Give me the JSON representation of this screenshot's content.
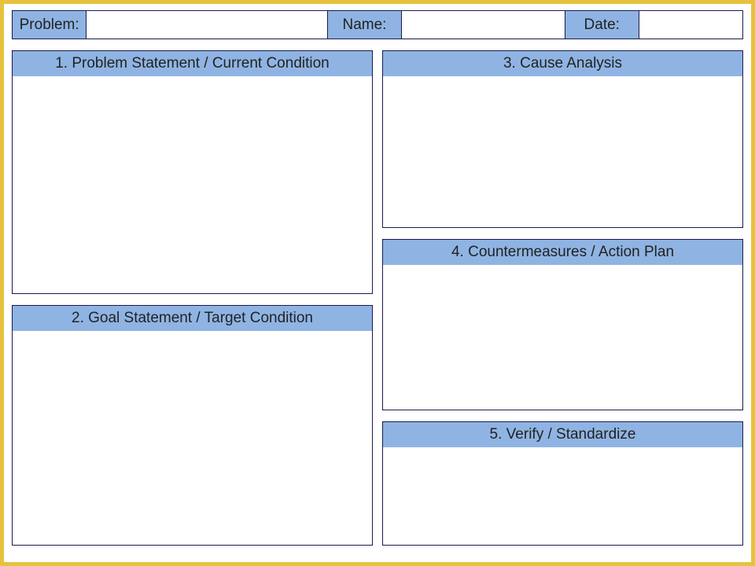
{
  "header": {
    "problem_label": "Problem:",
    "problem_value": "",
    "name_label": "Name:",
    "name_value": "",
    "date_label": "Date:",
    "date_value": ""
  },
  "panels": {
    "p1": "1.  Problem Statement / Current Condition",
    "p2": "2.  Goal Statement  / Target Condition",
    "p3": "3. Cause Analysis",
    "p4": "4. Countermeasures / Action Plan",
    "p5": "5. Verify / Standardize"
  }
}
